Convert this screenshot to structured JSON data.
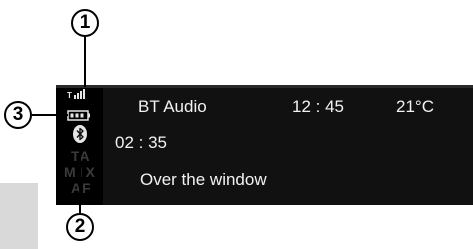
{
  "display": {
    "source": "BT Audio",
    "clock": "12 : 45",
    "temperature": "21°C",
    "elapsed": "02 : 35",
    "track": "Over the window"
  },
  "side_indicators": [
    "TA",
    "MIX",
    "AF"
  ],
  "callouts": {
    "one": "1",
    "two": "2",
    "three": "3"
  },
  "icons": [
    "signal-strength-icon",
    "battery-icon",
    "bluetooth-icon"
  ],
  "colors": {
    "display_bg": "#111111",
    "display_text": "#f2f2f2",
    "indicator_dim": "#3a3a3a"
  }
}
